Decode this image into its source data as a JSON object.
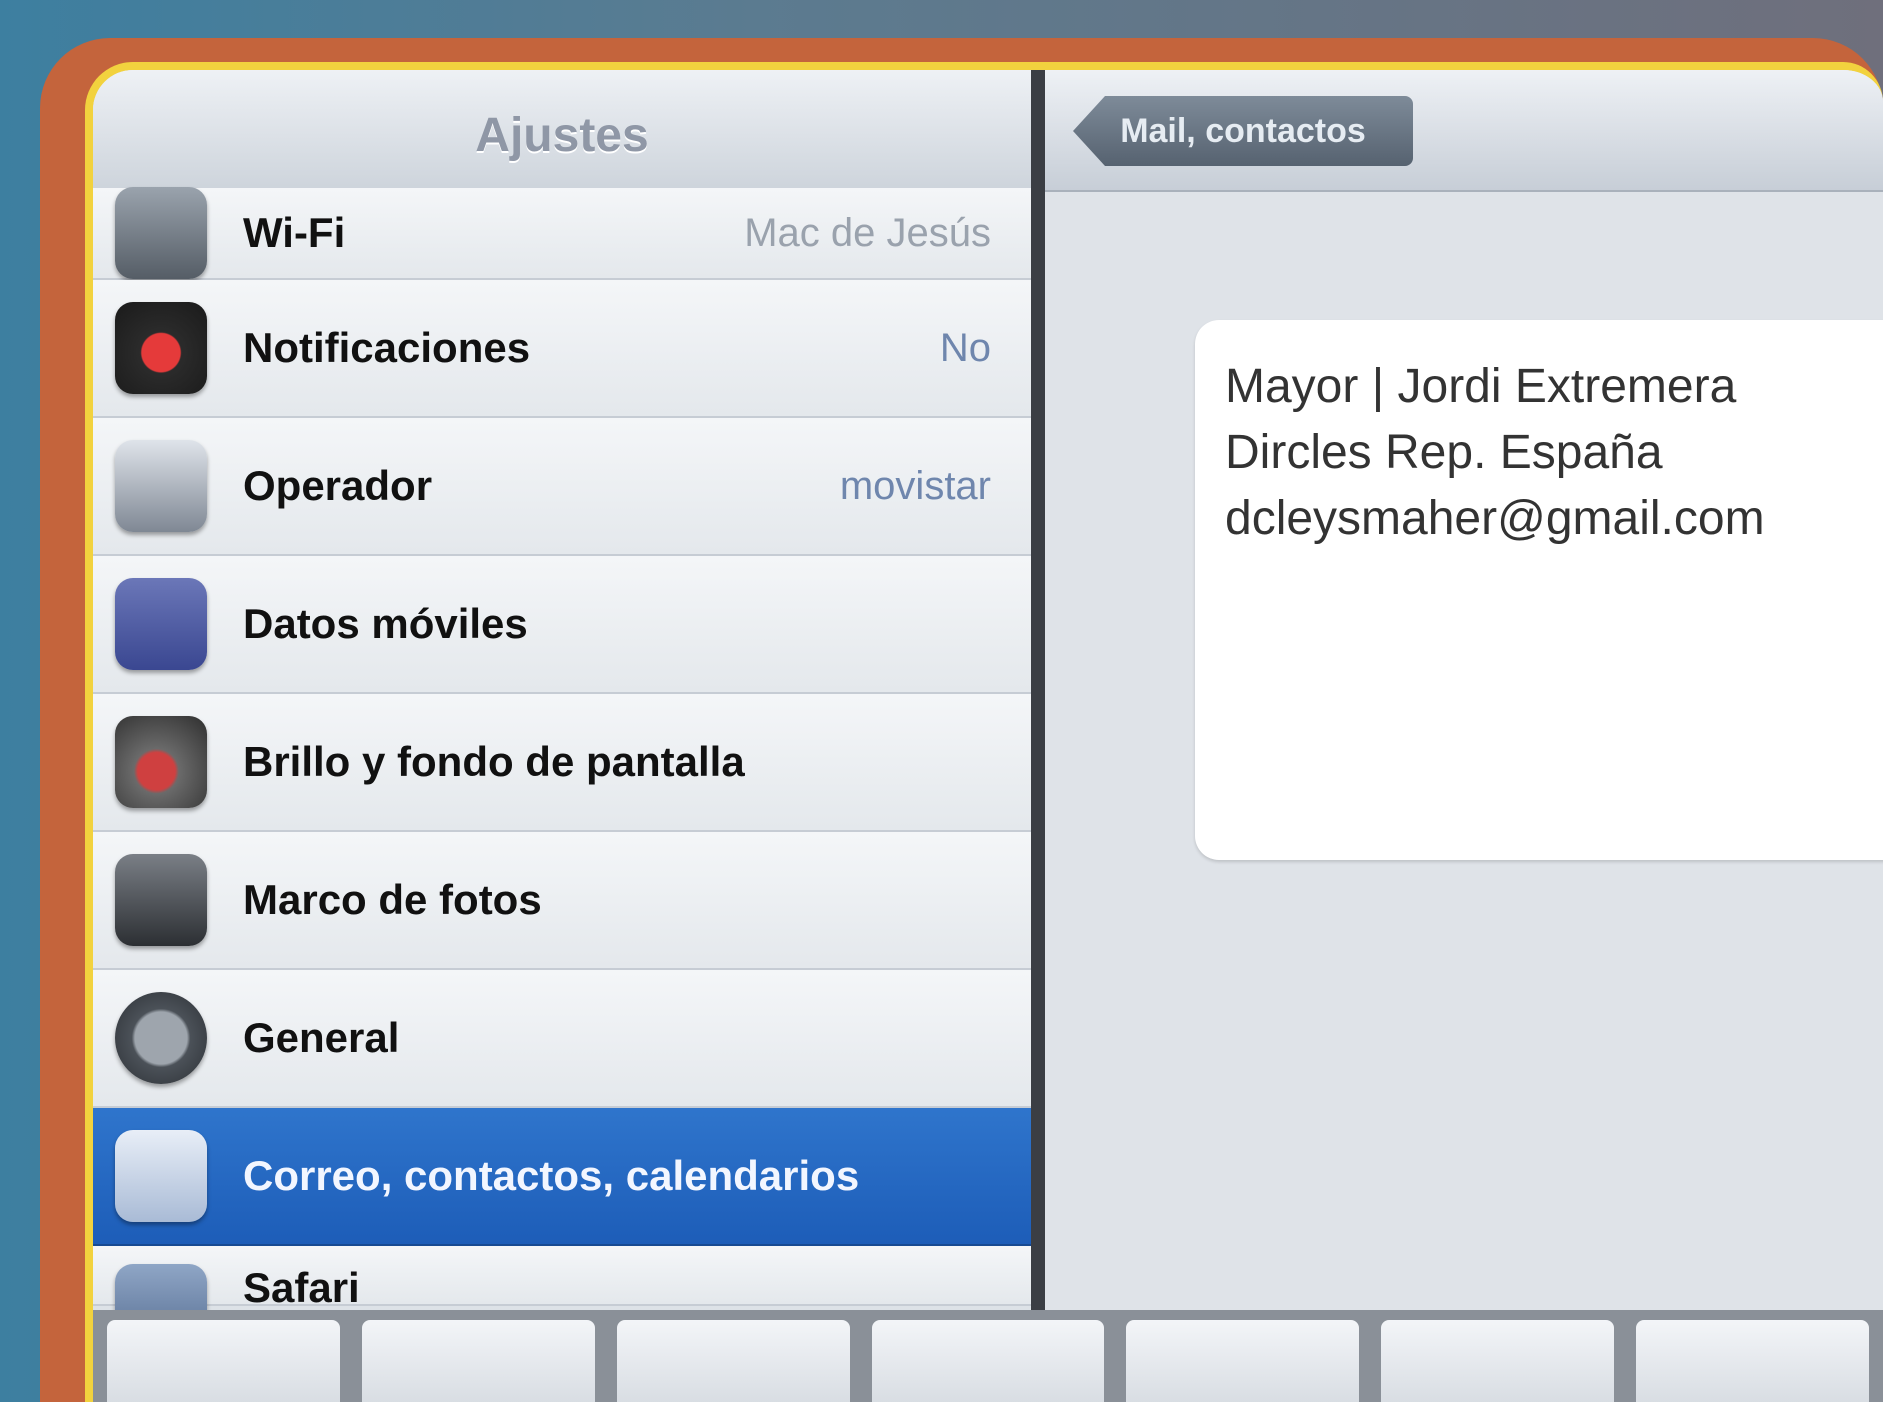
{
  "master": {
    "title": "Ajustes",
    "items": [
      {
        "label": "Wi-Fi",
        "value": "Mac de Jesús",
        "icon": "wifi-icon"
      },
      {
        "label": "Notificaciones",
        "value": "No",
        "icon": "notifications-icon"
      },
      {
        "label": "Operador",
        "value": "movistar",
        "icon": "carrier-icon"
      },
      {
        "label": "Datos móviles",
        "value": "",
        "icon": "cellular-data-icon"
      },
      {
        "label": "Brillo y fondo de pantalla",
        "value": "",
        "icon": "brightness-icon"
      },
      {
        "label": "Marco de fotos",
        "value": "",
        "icon": "picture-frame-icon"
      },
      {
        "label": "General",
        "value": "",
        "icon": "general-gear-icon"
      },
      {
        "label": "Correo, contactos, calendarios",
        "value": "",
        "icon": "mail-icon",
        "selected": true
      },
      {
        "label": "Safari",
        "value": "",
        "icon": "safari-icon"
      }
    ]
  },
  "detail": {
    "back_label": "Mail, contactos",
    "signature_lines": [
      "Mayor | Jordi Extremera",
      "Dircles Rep. España",
      "dcleysmaher@gmail.com"
    ]
  },
  "colors": {
    "selection": "#1d5db8",
    "frame_orange": "#c4643c",
    "frame_yellow": "#f2d23e"
  }
}
